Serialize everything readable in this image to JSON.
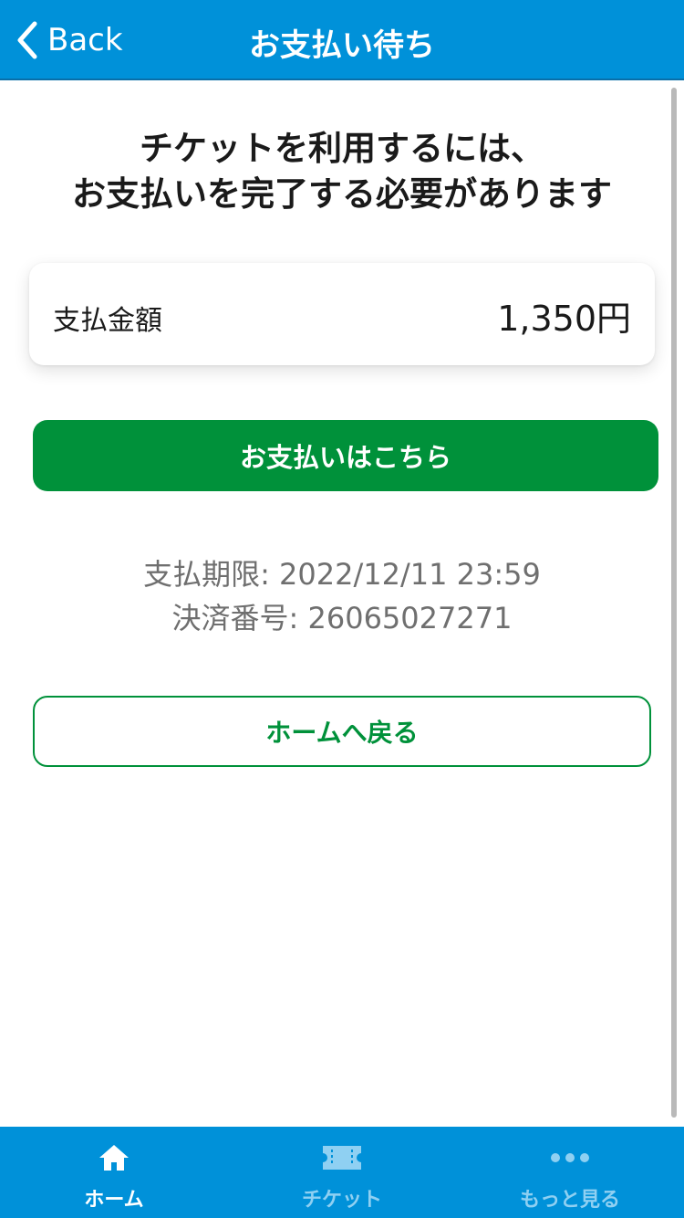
{
  "header": {
    "back_label": "Back",
    "title": "お支払い待ち"
  },
  "main": {
    "heading_line1": "チケットを利用するには、",
    "heading_line2": "お支払いを完了する必要があります",
    "amount_label": "支払金額",
    "amount_value": "1,350円",
    "pay_button_label": "お支払いはこちら",
    "deadline_text": "支払期限: 2022/12/11 23:59",
    "payment_number_text": "決済番号: 26065027271",
    "home_button_label": "ホームへ戻る"
  },
  "tabbar": {
    "items": [
      {
        "label": "ホーム",
        "icon": "home-icon",
        "active": true
      },
      {
        "label": "チケット",
        "icon": "ticket-icon",
        "active": false
      },
      {
        "label": "もっと見る",
        "icon": "more-icon",
        "active": false
      }
    ]
  },
  "colors": {
    "header_bg": "#0091d9",
    "accent_green": "#00913a",
    "muted_text": "#6f6f6f",
    "tab_inactive": "#8fd0f2"
  }
}
